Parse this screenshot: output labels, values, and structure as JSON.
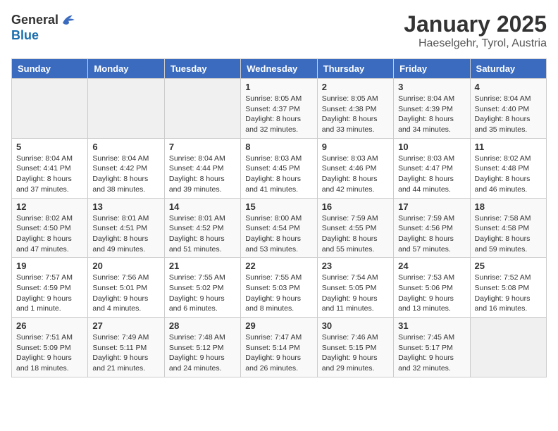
{
  "header": {
    "logo_general": "General",
    "logo_blue": "Blue",
    "month": "January 2025",
    "location": "Haeselgehr, Tyrol, Austria"
  },
  "weekdays": [
    "Sunday",
    "Monday",
    "Tuesday",
    "Wednesday",
    "Thursday",
    "Friday",
    "Saturday"
  ],
  "weeks": [
    [
      {
        "day": "",
        "info": ""
      },
      {
        "day": "",
        "info": ""
      },
      {
        "day": "",
        "info": ""
      },
      {
        "day": "1",
        "info": "Sunrise: 8:05 AM\nSunset: 4:37 PM\nDaylight: 8 hours and 32 minutes."
      },
      {
        "day": "2",
        "info": "Sunrise: 8:05 AM\nSunset: 4:38 PM\nDaylight: 8 hours and 33 minutes."
      },
      {
        "day": "3",
        "info": "Sunrise: 8:04 AM\nSunset: 4:39 PM\nDaylight: 8 hours and 34 minutes."
      },
      {
        "day": "4",
        "info": "Sunrise: 8:04 AM\nSunset: 4:40 PM\nDaylight: 8 hours and 35 minutes."
      }
    ],
    [
      {
        "day": "5",
        "info": "Sunrise: 8:04 AM\nSunset: 4:41 PM\nDaylight: 8 hours and 37 minutes."
      },
      {
        "day": "6",
        "info": "Sunrise: 8:04 AM\nSunset: 4:42 PM\nDaylight: 8 hours and 38 minutes."
      },
      {
        "day": "7",
        "info": "Sunrise: 8:04 AM\nSunset: 4:44 PM\nDaylight: 8 hours and 39 minutes."
      },
      {
        "day": "8",
        "info": "Sunrise: 8:03 AM\nSunset: 4:45 PM\nDaylight: 8 hours and 41 minutes."
      },
      {
        "day": "9",
        "info": "Sunrise: 8:03 AM\nSunset: 4:46 PM\nDaylight: 8 hours and 42 minutes."
      },
      {
        "day": "10",
        "info": "Sunrise: 8:03 AM\nSunset: 4:47 PM\nDaylight: 8 hours and 44 minutes."
      },
      {
        "day": "11",
        "info": "Sunrise: 8:02 AM\nSunset: 4:48 PM\nDaylight: 8 hours and 46 minutes."
      }
    ],
    [
      {
        "day": "12",
        "info": "Sunrise: 8:02 AM\nSunset: 4:50 PM\nDaylight: 8 hours and 47 minutes."
      },
      {
        "day": "13",
        "info": "Sunrise: 8:01 AM\nSunset: 4:51 PM\nDaylight: 8 hours and 49 minutes."
      },
      {
        "day": "14",
        "info": "Sunrise: 8:01 AM\nSunset: 4:52 PM\nDaylight: 8 hours and 51 minutes."
      },
      {
        "day": "15",
        "info": "Sunrise: 8:00 AM\nSunset: 4:54 PM\nDaylight: 8 hours and 53 minutes."
      },
      {
        "day": "16",
        "info": "Sunrise: 7:59 AM\nSunset: 4:55 PM\nDaylight: 8 hours and 55 minutes."
      },
      {
        "day": "17",
        "info": "Sunrise: 7:59 AM\nSunset: 4:56 PM\nDaylight: 8 hours and 57 minutes."
      },
      {
        "day": "18",
        "info": "Sunrise: 7:58 AM\nSunset: 4:58 PM\nDaylight: 8 hours and 59 minutes."
      }
    ],
    [
      {
        "day": "19",
        "info": "Sunrise: 7:57 AM\nSunset: 4:59 PM\nDaylight: 9 hours and 1 minute."
      },
      {
        "day": "20",
        "info": "Sunrise: 7:56 AM\nSunset: 5:01 PM\nDaylight: 9 hours and 4 minutes."
      },
      {
        "day": "21",
        "info": "Sunrise: 7:55 AM\nSunset: 5:02 PM\nDaylight: 9 hours and 6 minutes."
      },
      {
        "day": "22",
        "info": "Sunrise: 7:55 AM\nSunset: 5:03 PM\nDaylight: 9 hours and 8 minutes."
      },
      {
        "day": "23",
        "info": "Sunrise: 7:54 AM\nSunset: 5:05 PM\nDaylight: 9 hours and 11 minutes."
      },
      {
        "day": "24",
        "info": "Sunrise: 7:53 AM\nSunset: 5:06 PM\nDaylight: 9 hours and 13 minutes."
      },
      {
        "day": "25",
        "info": "Sunrise: 7:52 AM\nSunset: 5:08 PM\nDaylight: 9 hours and 16 minutes."
      }
    ],
    [
      {
        "day": "26",
        "info": "Sunrise: 7:51 AM\nSunset: 5:09 PM\nDaylight: 9 hours and 18 minutes."
      },
      {
        "day": "27",
        "info": "Sunrise: 7:49 AM\nSunset: 5:11 PM\nDaylight: 9 hours and 21 minutes."
      },
      {
        "day": "28",
        "info": "Sunrise: 7:48 AM\nSunset: 5:12 PM\nDaylight: 9 hours and 24 minutes."
      },
      {
        "day": "29",
        "info": "Sunrise: 7:47 AM\nSunset: 5:14 PM\nDaylight: 9 hours and 26 minutes."
      },
      {
        "day": "30",
        "info": "Sunrise: 7:46 AM\nSunset: 5:15 PM\nDaylight: 9 hours and 29 minutes."
      },
      {
        "day": "31",
        "info": "Sunrise: 7:45 AM\nSunset: 5:17 PM\nDaylight: 9 hours and 32 minutes."
      },
      {
        "day": "",
        "info": ""
      }
    ]
  ]
}
